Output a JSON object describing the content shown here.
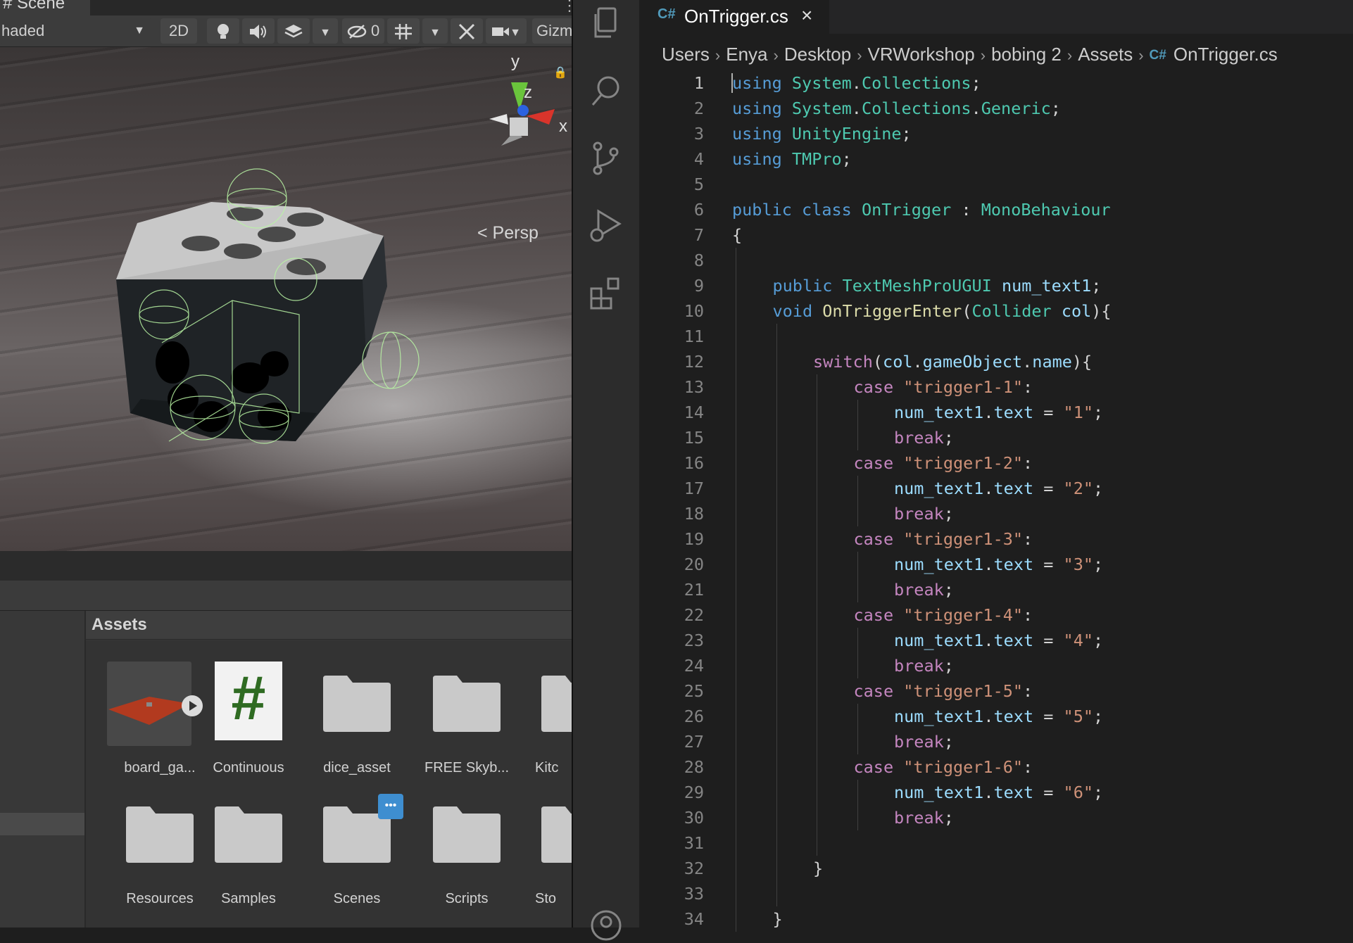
{
  "unity": {
    "scene_tab": "# Scene",
    "toolbar": {
      "shading_mode": "haded",
      "view_2d": "2D",
      "hidden_count": "0",
      "gizmos": "Gizm"
    },
    "viewport": {
      "persp_label": "< Persp",
      "axis_y": "y",
      "axis_z": "z",
      "axis_x": "x"
    },
    "project": {
      "breadcrumb_title": "Assets",
      "assets": [
        {
          "label": "board_ga...",
          "icon": "prefab-thumbnail"
        },
        {
          "label": "Continuous",
          "icon": "csharp-script-icon"
        },
        {
          "label": "dice_asset",
          "icon": "folder-icon"
        },
        {
          "label": "FREE Skyb...",
          "icon": "folder-icon"
        },
        {
          "label": "Kitc",
          "icon": "folder-icon"
        },
        {
          "label": "Resources",
          "icon": "folder-icon"
        },
        {
          "label": "Samples",
          "icon": "folder-icon"
        },
        {
          "label": "Scenes",
          "icon": "folder-icon"
        },
        {
          "label": "Scripts",
          "icon": "folder-icon"
        },
        {
          "label": "Sto",
          "icon": "folder-icon"
        }
      ],
      "hash_glyph": "#",
      "more_badge": "•••"
    }
  },
  "vscode": {
    "activity_bar": [
      "explorer-icon",
      "search-icon",
      "source-control-icon",
      "run-debug-icon",
      "extensions-icon",
      "accounts-icon"
    ],
    "tab": {
      "icon_text": "C#",
      "title": "OnTrigger.cs",
      "close": "×"
    },
    "breadcrumb": {
      "items": [
        "Users",
        "Enya",
        "Desktop",
        "VRWorkshop",
        "bobing 2",
        "Assets",
        "OnTrigger.cs"
      ],
      "separator": "›",
      "file_icon": "C#"
    },
    "current_line": 1,
    "code": [
      {
        "n": "1",
        "indent": 0,
        "tokens": [
          [
            "kw",
            "using"
          ],
          [
            "pl",
            " "
          ],
          [
            "ty",
            "System"
          ],
          [
            "pl",
            "."
          ],
          [
            "ty",
            "Collections"
          ],
          [
            "pl",
            ";"
          ]
        ]
      },
      {
        "n": "2",
        "indent": 0,
        "tokens": [
          [
            "kw",
            "using"
          ],
          [
            "pl",
            " "
          ],
          [
            "ty",
            "System"
          ],
          [
            "pl",
            "."
          ],
          [
            "ty",
            "Collections"
          ],
          [
            "pl",
            "."
          ],
          [
            "ty",
            "Generic"
          ],
          [
            "pl",
            ";"
          ]
        ]
      },
      {
        "n": "3",
        "indent": 0,
        "tokens": [
          [
            "kw",
            "using"
          ],
          [
            "pl",
            " "
          ],
          [
            "ty",
            "UnityEngine"
          ],
          [
            "pl",
            ";"
          ]
        ]
      },
      {
        "n": "4",
        "indent": 0,
        "tokens": [
          [
            "kw",
            "using"
          ],
          [
            "pl",
            " "
          ],
          [
            "ty",
            "TMPro"
          ],
          [
            "pl",
            ";"
          ]
        ]
      },
      {
        "n": "5",
        "indent": 0,
        "tokens": []
      },
      {
        "n": "6",
        "indent": 0,
        "tokens": [
          [
            "kw",
            "public"
          ],
          [
            "pl",
            " "
          ],
          [
            "kw",
            "class"
          ],
          [
            "pl",
            " "
          ],
          [
            "ty",
            "OnTrigger"
          ],
          [
            "pl",
            " : "
          ],
          [
            "ty",
            "MonoBehaviour"
          ]
        ]
      },
      {
        "n": "7",
        "indent": 0,
        "tokens": [
          [
            "pl",
            "{"
          ]
        ]
      },
      {
        "n": "8",
        "indent": 1,
        "tokens": []
      },
      {
        "n": "9",
        "indent": 1,
        "tokens": [
          [
            "kw",
            "public"
          ],
          [
            "pl",
            " "
          ],
          [
            "ty",
            "TextMeshProUGUI"
          ],
          [
            "pl",
            " "
          ],
          [
            "var",
            "num_text1"
          ],
          [
            "pl",
            ";"
          ]
        ]
      },
      {
        "n": "10",
        "indent": 1,
        "tokens": [
          [
            "kw",
            "void"
          ],
          [
            "pl",
            " "
          ],
          [
            "fn",
            "OnTriggerEnter"
          ],
          [
            "pl",
            "("
          ],
          [
            "ty",
            "Collider"
          ],
          [
            "pl",
            " "
          ],
          [
            "var",
            "col"
          ],
          [
            "pl",
            "){"
          ]
        ]
      },
      {
        "n": "11",
        "indent": 2,
        "tokens": []
      },
      {
        "n": "12",
        "indent": 2,
        "tokens": [
          [
            "ctl",
            "switch"
          ],
          [
            "pl",
            "("
          ],
          [
            "var",
            "col"
          ],
          [
            "pl",
            "."
          ],
          [
            "var",
            "gameObject"
          ],
          [
            "pl",
            "."
          ],
          [
            "var",
            "name"
          ],
          [
            "pl",
            "){"
          ]
        ]
      },
      {
        "n": "13",
        "indent": 3,
        "tokens": [
          [
            "ctl",
            "case"
          ],
          [
            "pl",
            " "
          ],
          [
            "str",
            "\"trigger1-1\""
          ],
          [
            "pl",
            ":"
          ]
        ]
      },
      {
        "n": "14",
        "indent": 4,
        "tokens": [
          [
            "var",
            "num_text1"
          ],
          [
            "pl",
            "."
          ],
          [
            "var",
            "text"
          ],
          [
            "pl",
            " = "
          ],
          [
            "str",
            "\"1\""
          ],
          [
            "pl",
            ";"
          ]
        ]
      },
      {
        "n": "15",
        "indent": 4,
        "tokens": [
          [
            "ctl",
            "break"
          ],
          [
            "pl",
            ";"
          ]
        ]
      },
      {
        "n": "16",
        "indent": 3,
        "tokens": [
          [
            "ctl",
            "case"
          ],
          [
            "pl",
            " "
          ],
          [
            "str",
            "\"trigger1-2\""
          ],
          [
            "pl",
            ":"
          ]
        ]
      },
      {
        "n": "17",
        "indent": 4,
        "tokens": [
          [
            "var",
            "num_text1"
          ],
          [
            "pl",
            "."
          ],
          [
            "var",
            "text"
          ],
          [
            "pl",
            " = "
          ],
          [
            "str",
            "\"2\""
          ],
          [
            "pl",
            ";"
          ]
        ]
      },
      {
        "n": "18",
        "indent": 4,
        "tokens": [
          [
            "ctl",
            "break"
          ],
          [
            "pl",
            ";"
          ]
        ]
      },
      {
        "n": "19",
        "indent": 3,
        "tokens": [
          [
            "ctl",
            "case"
          ],
          [
            "pl",
            " "
          ],
          [
            "str",
            "\"trigger1-3\""
          ],
          [
            "pl",
            ":"
          ]
        ]
      },
      {
        "n": "20",
        "indent": 4,
        "tokens": [
          [
            "var",
            "num_text1"
          ],
          [
            "pl",
            "."
          ],
          [
            "var",
            "text"
          ],
          [
            "pl",
            " = "
          ],
          [
            "str",
            "\"3\""
          ],
          [
            "pl",
            ";"
          ]
        ]
      },
      {
        "n": "21",
        "indent": 4,
        "tokens": [
          [
            "ctl",
            "break"
          ],
          [
            "pl",
            ";"
          ]
        ]
      },
      {
        "n": "22",
        "indent": 3,
        "tokens": [
          [
            "ctl",
            "case"
          ],
          [
            "pl",
            " "
          ],
          [
            "str",
            "\"trigger1-4\""
          ],
          [
            "pl",
            ":"
          ]
        ]
      },
      {
        "n": "23",
        "indent": 4,
        "tokens": [
          [
            "var",
            "num_text1"
          ],
          [
            "pl",
            "."
          ],
          [
            "var",
            "text"
          ],
          [
            "pl",
            " = "
          ],
          [
            "str",
            "\"4\""
          ],
          [
            "pl",
            ";"
          ]
        ]
      },
      {
        "n": "24",
        "indent": 4,
        "tokens": [
          [
            "ctl",
            "break"
          ],
          [
            "pl",
            ";"
          ]
        ]
      },
      {
        "n": "25",
        "indent": 3,
        "tokens": [
          [
            "ctl",
            "case"
          ],
          [
            "pl",
            " "
          ],
          [
            "str",
            "\"trigger1-5\""
          ],
          [
            "pl",
            ":"
          ]
        ]
      },
      {
        "n": "26",
        "indent": 4,
        "tokens": [
          [
            "var",
            "num_text1"
          ],
          [
            "pl",
            "."
          ],
          [
            "var",
            "text"
          ],
          [
            "pl",
            " = "
          ],
          [
            "str",
            "\"5\""
          ],
          [
            "pl",
            ";"
          ]
        ]
      },
      {
        "n": "27",
        "indent": 4,
        "tokens": [
          [
            "ctl",
            "break"
          ],
          [
            "pl",
            ";"
          ]
        ]
      },
      {
        "n": "28",
        "indent": 3,
        "tokens": [
          [
            "ctl",
            "case"
          ],
          [
            "pl",
            " "
          ],
          [
            "str",
            "\"trigger1-6\""
          ],
          [
            "pl",
            ":"
          ]
        ]
      },
      {
        "n": "29",
        "indent": 4,
        "tokens": [
          [
            "var",
            "num_text1"
          ],
          [
            "pl",
            "."
          ],
          [
            "var",
            "text"
          ],
          [
            "pl",
            " = "
          ],
          [
            "str",
            "\"6\""
          ],
          [
            "pl",
            ";"
          ]
        ]
      },
      {
        "n": "30",
        "indent": 4,
        "tokens": [
          [
            "ctl",
            "break"
          ],
          [
            "pl",
            ";"
          ]
        ]
      },
      {
        "n": "31",
        "indent": 3,
        "tokens": []
      },
      {
        "n": "32",
        "indent": 2,
        "tokens": [
          [
            "pl",
            "}"
          ]
        ]
      },
      {
        "n": "33",
        "indent": 2,
        "tokens": []
      },
      {
        "n": "34",
        "indent": 1,
        "tokens": [
          [
            "pl",
            "}"
          ]
        ]
      }
    ]
  }
}
